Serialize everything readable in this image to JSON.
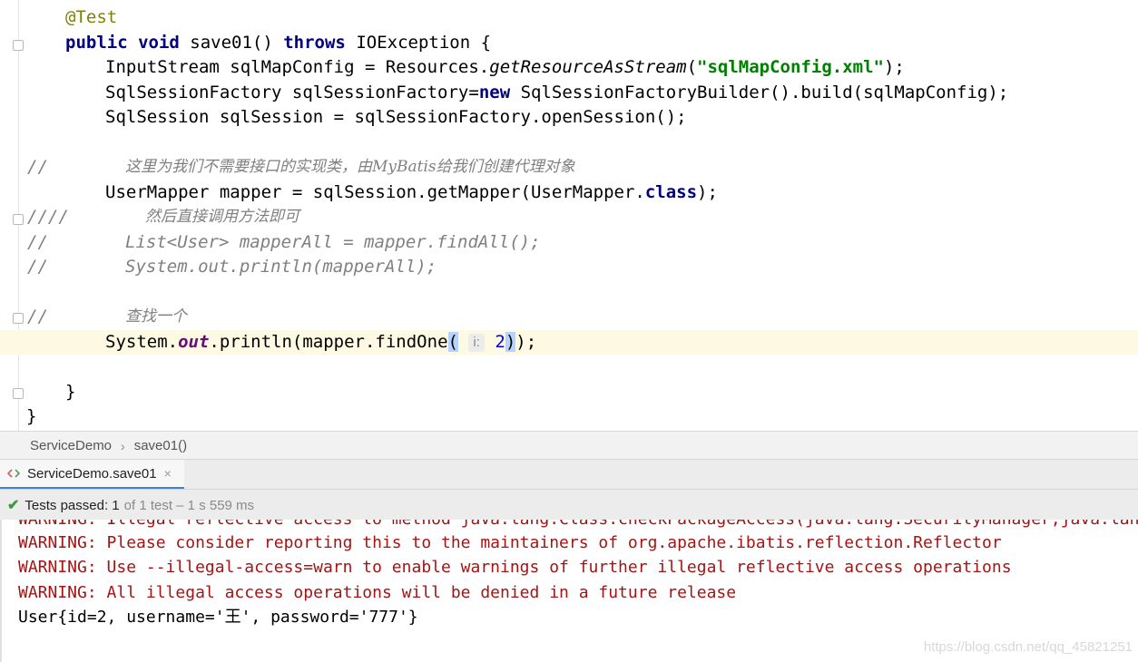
{
  "editor": {
    "annotation": "@Test",
    "method_sig": {
      "mod": "public void",
      "name": " save01() ",
      "throws": "throws",
      "rest": " IOException {"
    },
    "l3": {
      "a": "InputStream sqlMapConfig = Resources.",
      "b": "getResourceAsStream",
      "c": "(",
      "d": "\"sqlMapConfig.xml\"",
      "e": ");"
    },
    "l4": {
      "a": "SqlSessionFactory sqlSessionFactory=",
      "b": "new",
      "c": " SqlSessionFactoryBuilder().build(sqlMapConfig);"
    },
    "l5": "SqlSession sqlSession = sqlSessionFactory.openSession();",
    "c1_prefix": "//",
    "c1_text": "这里为我们不需要接口的实现类，由MyBatis给我们创建代理对象",
    "l7": {
      "a": "UserMapper mapper = sqlSession.getMapper(UserMapper.",
      "b": "class",
      "c": ");"
    },
    "c2_prefix": "////",
    "c2_text": "然后直接调用方法即可",
    "c3_prefix": "//",
    "c3_text": "List<User> mapperAll = mapper.findAll();",
    "c4_prefix": "//",
    "c4_text": "System.out.println(mapperAll);",
    "c5_prefix": "//",
    "c5_text": "查找一个",
    "l12": {
      "a": "System.",
      "b": "out",
      "c": ".println(mapper.findOne",
      "d": "(",
      "hint": "i:",
      "e": "2",
      "f": ")",
      "g": ");"
    },
    "close_method": "}",
    "close_class": "}"
  },
  "breadcrumb": {
    "items": [
      "ServiceDemo",
      "save01()"
    ],
    "separator": "›"
  },
  "run_tab": {
    "label": "ServiceDemo.save01",
    "close": "×"
  },
  "status": {
    "check": "✔",
    "passed": "Tests passed: ",
    "count": "1",
    "meta": "of 1 test – 1 s 559 ms"
  },
  "console": {
    "cut_line": "WARNING: Illegal reflective access to method java.lang.Class.checkPackageAccess(java.lang.SecurityManager,java.lang.ClassLoader,boolean)",
    "lines": [
      "WARNING: Please consider reporting this to the maintainers of org.apache.ibatis.reflection.Reflector",
      "WARNING: Use --illegal-access=warn to enable warnings of further illegal reflective access operations",
      "WARNING: All illegal access operations will be denied in a future release"
    ],
    "output": "User{id=2, username='王', password='777'}"
  },
  "watermark": "https://blog.csdn.net/qq_45821251",
  "colors": {
    "keyword": "#000080",
    "string": "#008000",
    "comment": "#808080",
    "annotation": "#808000",
    "error": "#a31515",
    "pass": "#3c9a3c",
    "tab_accent": "#4083c9"
  }
}
